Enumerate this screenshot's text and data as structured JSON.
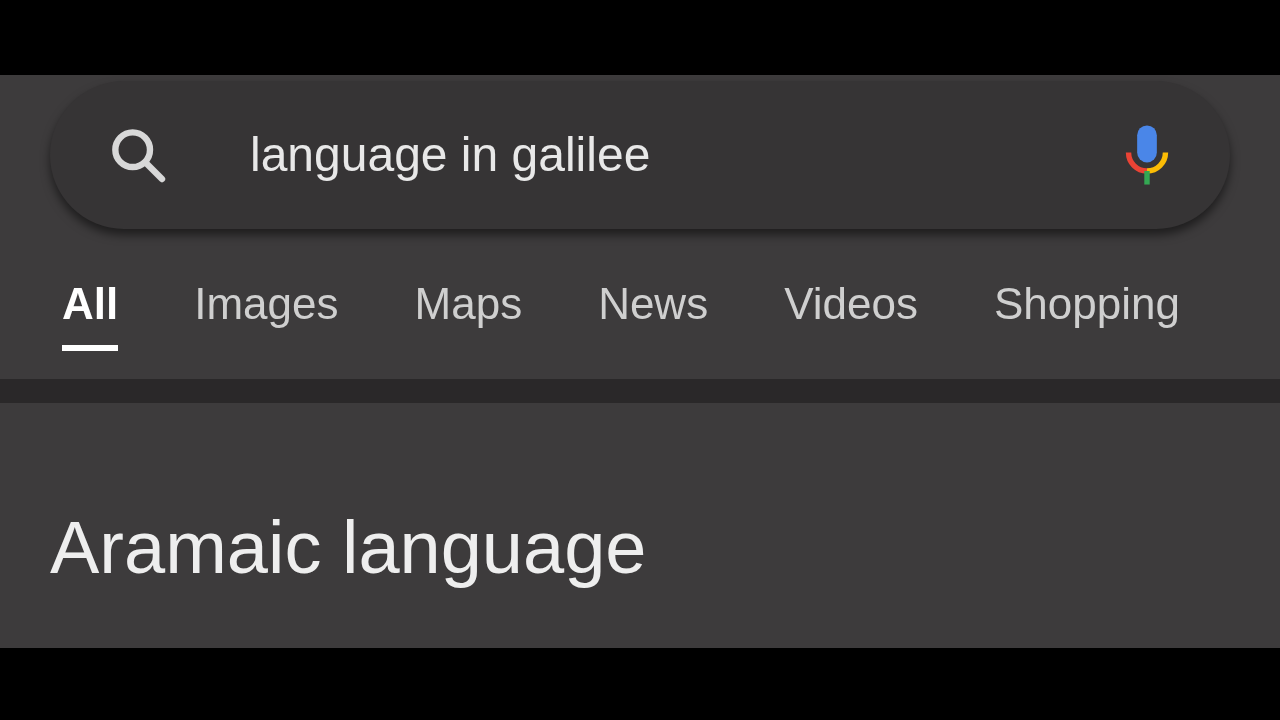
{
  "search": {
    "value": "language in galilee"
  },
  "tabs": [
    {
      "label": "All",
      "selected": true
    },
    {
      "label": "Images",
      "selected": false
    },
    {
      "label": "Maps",
      "selected": false
    },
    {
      "label": "News",
      "selected": false
    },
    {
      "label": "Videos",
      "selected": false
    },
    {
      "label": "Shopping",
      "selected": false
    }
  ],
  "result": {
    "title": "Aramaic language"
  }
}
